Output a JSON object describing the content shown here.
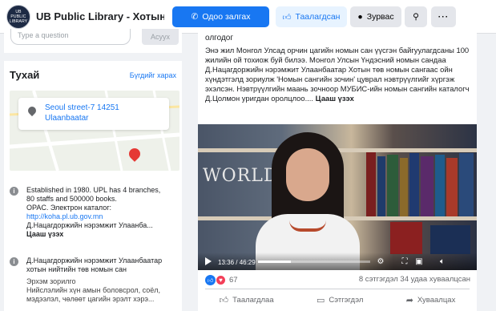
{
  "header": {
    "logo_text": "UB PUBLIC LIBRARY",
    "title": "UB Public Library - Хотын...",
    "message_button": "Одоо залгах",
    "liked_button": "Таалагдсан",
    "chat_button": "Зурвас",
    "search_icon": "search-icon",
    "more_icon": "more-icon",
    "accent": "#1877f2"
  },
  "ask": {
    "placeholder": "Type a question",
    "button": "Асуух"
  },
  "about": {
    "title": "Тухай",
    "edit_link": "Бүгдийг харах",
    "map": {
      "address_line1": "Seoul street-7 14251",
      "address_line2": "Ulaanbaatar"
    },
    "info1": {
      "line1": "Established in 1980. UPL has 4 branches,",
      "line2": "80 staffs and 500000 books.",
      "line3": "OPAC. Электрон каталог:",
      "link": "http://koha.pl.ub.gov.mn",
      "line5": "Д.Нацагдоржийн нэрэмжит Улаанба...",
      "see_more": "Цааш үзэх"
    },
    "info2": {
      "line1": "Д.Нацагдоржийн нэрэмжит Улаанбаатар",
      "line2": "хотын нийтийн төв номын сан",
      "line3": "Эрхэм зорилго",
      "line4": "Нийслэлийн хүн амын боловсрол, соёл,",
      "line5": "мэдээлэл, чөлөөт цагийн эрэлт хэрэ..."
    }
  },
  "post": {
    "heading": "олгодог",
    "text": "Энэ жил Монгол Улсад орчин цагийн номын сан үүсгэн байгуулагдсаны 100 жилийн ой тохиож буй билээ. Монгол Улсын Үндэсний номын сандаа Д.Нацагдоржийн нэрэмжит Улаанбаатар Хотын төв номын сангаас ойн хүндэтгэлд зориулж 'Номын сангийн зочин' цуврал нэвтрүүлгийг хүргэж эхэлсэн. Нэвтрүүлгийн маань зочноор МУБИС-ийн номын сангийн каталогч Д.Цолмон уригдан оролцлоо....",
    "see_more": "Цааш үзэх",
    "video": {
      "overlay_word": "WORLD",
      "time": "13:36 / 46:29",
      "progress": 0.293
    },
    "reactions_count": "67",
    "stats": "8 сэтгэгдэл  34 удаа хуваалцсан",
    "actions": {
      "like": "Таалагдлаа",
      "comment": "Сэтгэгдэл",
      "share": "Хуваалцах"
    }
  }
}
